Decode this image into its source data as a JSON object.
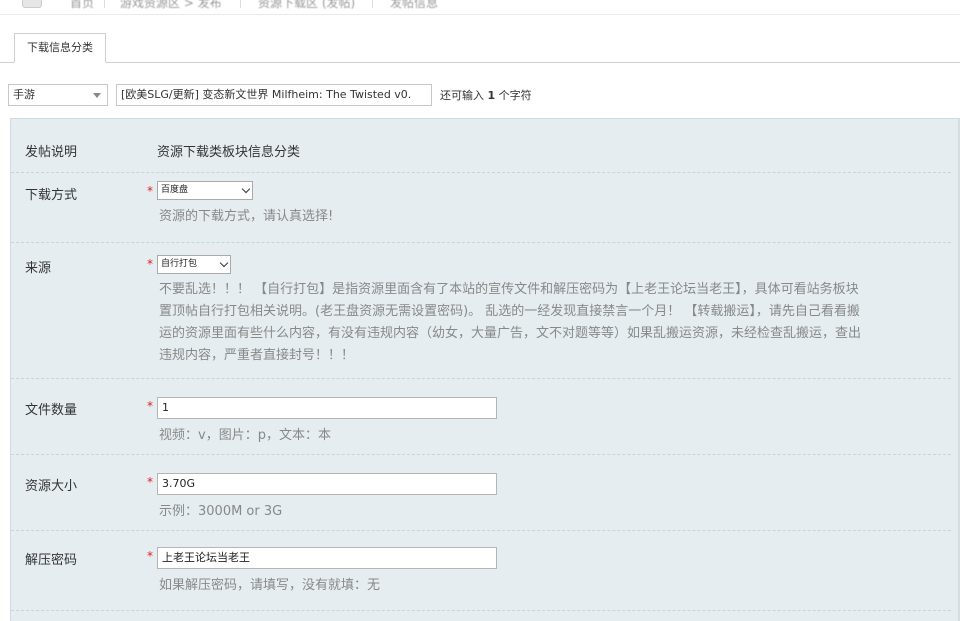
{
  "nav": {
    "crumbs": [
      "首页",
      "游戏资源区 > 发布",
      "资源下载区 (发帖)",
      "发帖信息"
    ]
  },
  "tab": {
    "label": "下载信息分类"
  },
  "title_row": {
    "category": "手游",
    "title_value": "[欧美SLG/更新] 变态新文世界 Milfheim: The Twisted v0.",
    "hint_prefix": "还可输入",
    "hint_count": "1",
    "hint_suffix": "个字符"
  },
  "form": {
    "post_note": {
      "label": "发帖说明",
      "text": "资源下载类板块信息分类"
    },
    "download_method": {
      "label": "下载方式",
      "required": "*",
      "selected": "百度盘",
      "help": "资源的下载方式，请认真选择!"
    },
    "source": {
      "label": "来源",
      "required": "*",
      "selected": "自行打包",
      "help_lines": [
        "不要乱选！！！ 【自行打包】是指资源里面含有了本站的宣传文件和解压密码为【上老王论坛当老王】，具体可看站务板块",
        "置顶帖自行打包相关说明。(老王盘资源无需设置密码)。 乱选的一经发现直接禁言一个月！ 【转载搬运】，请先自己看看搬",
        "运的资源里面有些什么内容，有没有违规内容（幼女，大量广告，文不对题等等）如果乱搬运资源，未经检查乱搬运，查出",
        "违规内容，严重者直接封号！！！"
      ]
    },
    "file_count": {
      "label": "文件数量",
      "required": "*",
      "value": "1",
      "help": "视频：v，图片：p，文本：本"
    },
    "resource_size": {
      "label": "资源大小",
      "required": "*",
      "value": "3.70G",
      "help": "示例：3000M or 3G"
    },
    "unzip_password": {
      "label": "解压密码",
      "required": "*",
      "value": "上老王论坛当老王",
      "help": "如果解压密码，请填写，没有就填：无"
    }
  },
  "colors": {
    "panel_bg": "#e6edf1",
    "required": "#e02020",
    "help_text": "#888888"
  }
}
